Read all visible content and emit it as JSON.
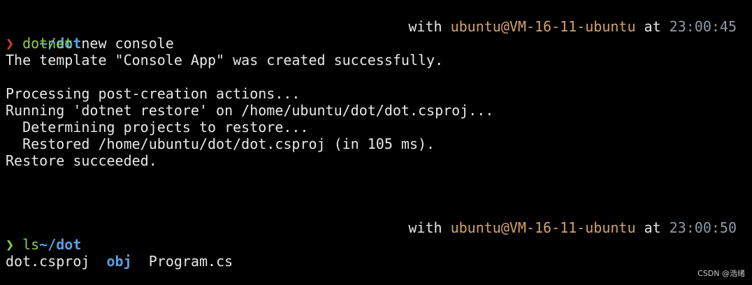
{
  "colors": {
    "background": "#000000",
    "text": "#e8e8e8",
    "path": "#5aa0e0",
    "prompt_error": "#e03c3c",
    "prompt_ok": "#8ecf4a",
    "command": "#8ecf4a",
    "user_host": "#d2a36a",
    "time": "#8e9aa6"
  },
  "prompt1": {
    "path": "~/dot",
    "with": "with ",
    "user_host": "ubuntu@VM-16-11-ubuntu",
    "at": " at ",
    "time": "23:00:45",
    "arrow": "❯",
    "command": "dotnet",
    "args": " new console"
  },
  "output1": [
    "The template \"Console App\" was created successfully.",
    "",
    "Processing post-creation actions...",
    "Running 'dotnet restore' on /home/ubuntu/dot/dot.csproj...",
    "  Determining projects to restore...",
    "  Restored /home/ubuntu/dot/dot.csproj (in 105 ms).",
    "Restore succeeded."
  ],
  "prompt2": {
    "path": "~/dot",
    "with": "with ",
    "user_host": "ubuntu@VM-16-11-ubuntu",
    "at": " at ",
    "time": "23:00:50",
    "arrow": "❯",
    "command": "ls"
  },
  "ls_output": {
    "file1": "dot.csproj",
    "dir1": "obj",
    "file2": "Program.cs"
  },
  "watermark": "CSDN @浩绪"
}
